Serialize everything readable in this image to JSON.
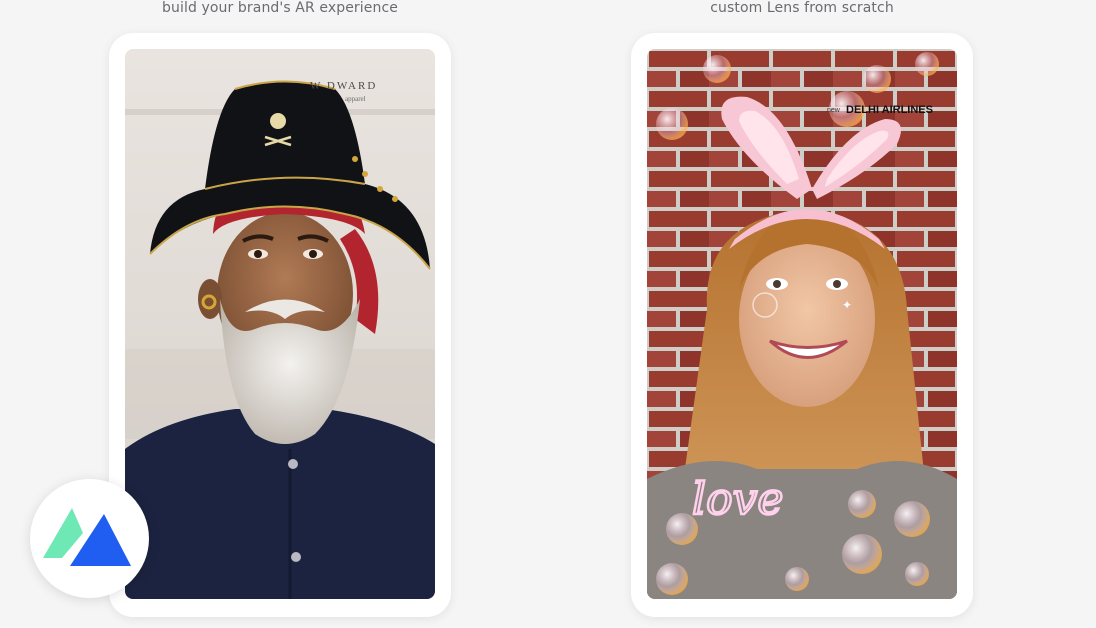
{
  "captions": {
    "left": "build your brand's AR experience",
    "right": "custom Lens from scratch"
  },
  "left_card": {
    "watermark": "W    DWARD",
    "watermark_sub": "apparel",
    "image_subject": "pirate-lens-photo"
  },
  "right_card": {
    "airline_prefix": "new",
    "airline_name": "DELHI AIRLINES",
    "overlay_text": "love",
    "image_subject": "bunny-ears-lens-photo"
  },
  "badge": {
    "icon": "logo-icon",
    "colors": {
      "green": "#6ee8b4",
      "blue": "#1f5ef0"
    }
  }
}
